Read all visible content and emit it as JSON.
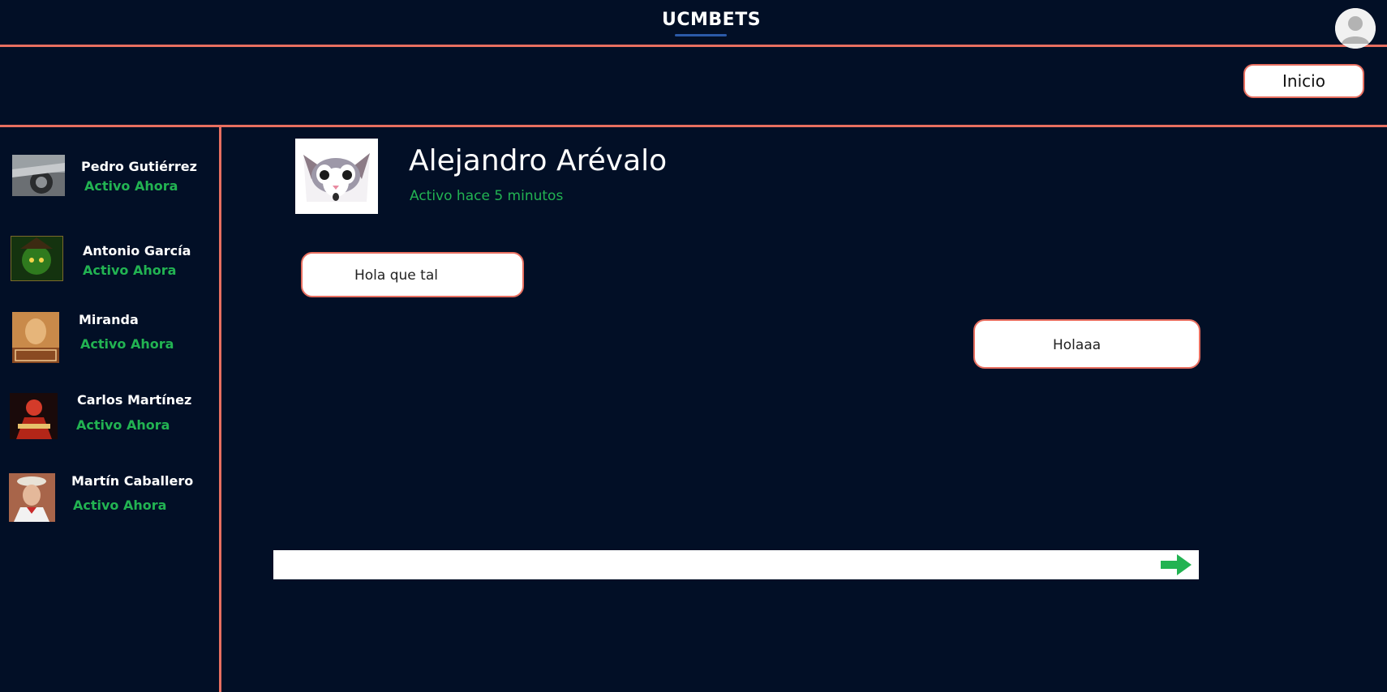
{
  "header": {
    "logo": "UCMBETS",
    "nav_button": "Inicio"
  },
  "contacts": [
    {
      "name": "Pedro Gutiérrez",
      "status": "Activo Ahora"
    },
    {
      "name": "Antonio García",
      "status": "Activo Ahora"
    },
    {
      "name": "Miranda",
      "status": "Activo Ahora"
    },
    {
      "name": "Carlos Martínez",
      "status": "Activo Ahora"
    },
    {
      "name": "Martín Caballero",
      "status": "Activo Ahora"
    }
  ],
  "chat": {
    "contact_name": "Alejandro Arévalo",
    "contact_status": "Activo hace 5 minutos",
    "messages": [
      {
        "direction": "in",
        "text": "Hola que tal"
      },
      {
        "direction": "out",
        "text": "Holaaa"
      }
    ],
    "input": {
      "value": "",
      "placeholder": ""
    }
  },
  "icons": {
    "user": "user-icon",
    "send": "arrow-right-icon"
  },
  "colors": {
    "background": "#020f26",
    "accent": "#e86f60",
    "status_green": "#22b352",
    "send_arrow": "#22b352"
  }
}
